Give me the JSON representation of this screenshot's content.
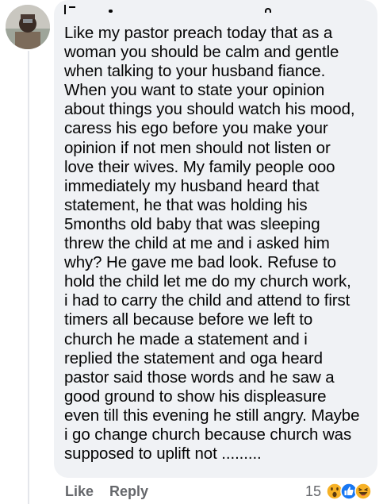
{
  "comment": {
    "author_name": "",
    "text": "Like my pastor preach today that as a\nwoman you should be calm and gentle\nwhen talking to your husband fiance.\nWhen you want to state your opinion\nabout things you should watch his mood,\ncaress his ego before you make your\nopinion if not men should not listen or\nlove their wives. My family people ooo\nimmediately my husband heard that\nstatement, he that was holding his\n5months old baby that was sleeping\nthrew the child at me and i asked him\nwhy? He gave me bad look. Refuse to\nhold the child let me do my church work,\ni had to carry the child and attend to first\ntimers all because before we left to\nchurch he made a statement and i\nreplied the statement and oga heard\npastor said those words and he saw a\ngood ground to show his displeasure\neven till this evening he still angry. Maybe\ni go change church because church was\nsupposed to uplift not ........."
  },
  "actions": {
    "like_label": "Like",
    "reply_label": "Reply"
  },
  "reactions": {
    "count": "15",
    "icons": [
      "wow-reaction-icon",
      "like-reaction-icon",
      "haha-reaction-icon"
    ]
  },
  "colors": {
    "bubble_bg": "#f0f2f5",
    "text": "#050505",
    "meta_text": "#65676b",
    "like_blue": "#1877f2",
    "emoji_yellow": "#f7b125"
  }
}
